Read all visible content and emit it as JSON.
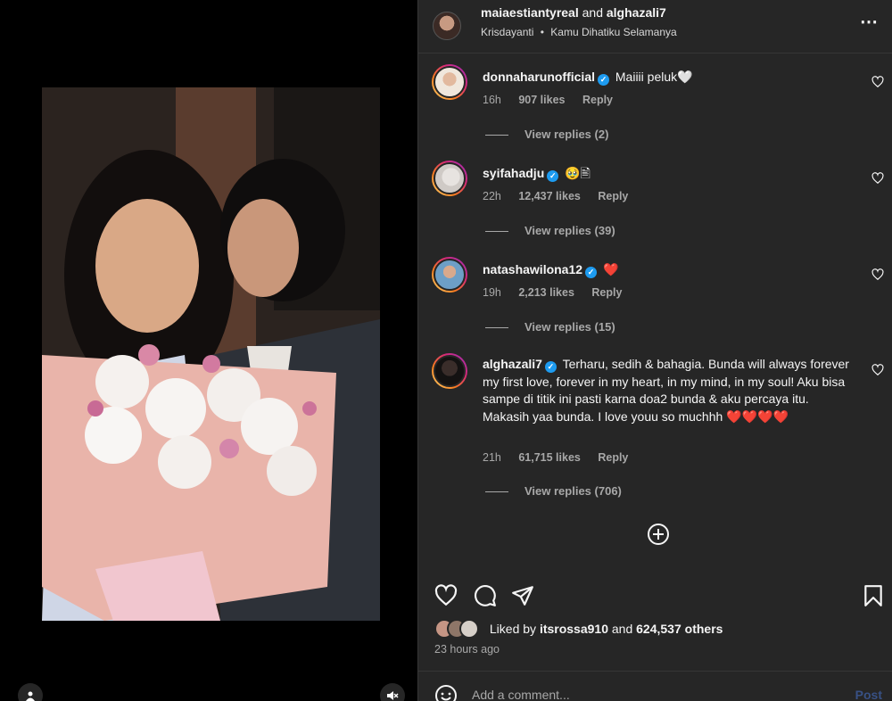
{
  "header": {
    "author": "maiaestiantyreal",
    "and_text": "and",
    "coauthor": "alghazali7",
    "audio_artist": "Krisdayanti",
    "audio_sep": "•",
    "audio_title": "Kamu Dihatiku Selamanya",
    "more_icon": "more-horizontal-icon"
  },
  "comments": [
    {
      "username": "donnaharunofficial",
      "verified": true,
      "text": "Maiiii peluk🤍",
      "time": "16h",
      "likes": "907 likes",
      "reply": "Reply",
      "view_replies": "View replies (2)"
    },
    {
      "username": "syifahadju",
      "verified": true,
      "text": "🥹🖹",
      "time": "22h",
      "likes": "12,437 likes",
      "reply": "Reply",
      "view_replies": "View replies (39)"
    },
    {
      "username": "natashawilona12",
      "verified": true,
      "text": "❤️",
      "time": "19h",
      "likes": "2,213 likes",
      "reply": "Reply",
      "view_replies": "View replies (15)"
    },
    {
      "username": "alghazali7",
      "verified": true,
      "text": "Terharu, sedih & bahagia. Bunda will always forever my first love, forever in my heart, in my mind, in my soul! Aku bisa sampe di titik ini pasti karna doa2 bunda & aku percaya itu. Makasih yaa bunda. I love youu so muchhh ❤️❤️❤️❤️",
      "time": "21h",
      "likes": "61,715 likes",
      "reply": "Reply",
      "view_replies": "View replies (706)"
    }
  ],
  "liked_by": {
    "prefix": "Liked by",
    "user": "itsrossa910",
    "and_text": "and",
    "others": "624,537 others"
  },
  "timestamp": "23 hours ago",
  "add_comment": {
    "placeholder": "Add a comment...",
    "post_label": "Post"
  },
  "colors": {
    "panel_bg": "#262626",
    "secondary_text": "#a8a8a8",
    "verified_blue": "#1d9bf0",
    "post_button": "#385185"
  }
}
